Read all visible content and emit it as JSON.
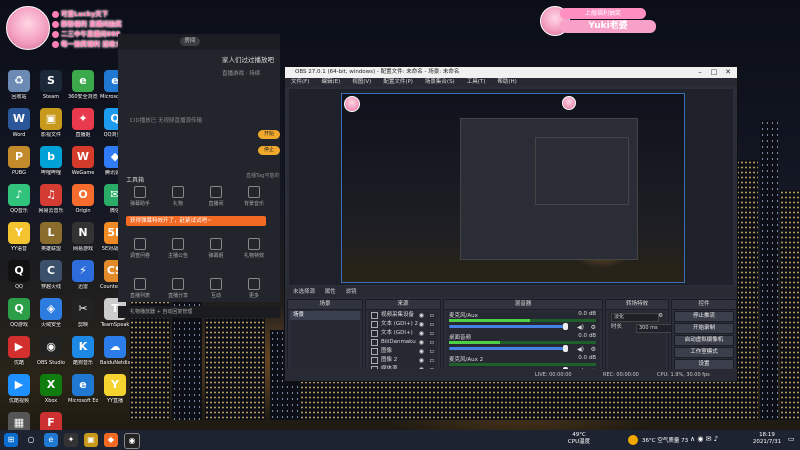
{
  "overlay": {
    "lines": [
      "可爱Lucky天下",
      "新粉福利 直播间抽奖",
      "二三中午直播间888",
      "每一抽奖福利 送给大家"
    ],
    "yuki_top": "上舰福利抽奖",
    "yuki_name": "Yuki老婆"
  },
  "desktop_icons": [
    {
      "label": "回收站",
      "glyph": "♻",
      "color": "#6b8bb5"
    },
    {
      "label": "Steam",
      "glyph": "S",
      "color": "#1b2838"
    },
    {
      "label": "360安全浏览器",
      "glyph": "e",
      "color": "#3aa84b"
    },
    {
      "label": "Microsoft Edge",
      "glyph": "e",
      "color": "#1f78d1"
    },
    {
      "label": "Word",
      "glyph": "W",
      "color": "#2b579a"
    },
    {
      "label": "影视文件",
      "glyph": "▣",
      "color": "#c79a1c"
    },
    {
      "label": "直播姬",
      "glyph": "✦",
      "color": "#e83a4c"
    },
    {
      "label": "QQ浏览器",
      "glyph": "Q",
      "color": "#1d9bf0"
    },
    {
      "label": "PUBG",
      "glyph": "P",
      "color": "#c28a2a"
    },
    {
      "label": "哔哩哔哩",
      "glyph": "b",
      "color": "#00a1d6"
    },
    {
      "label": "WeGame",
      "glyph": "W",
      "color": "#d43b2a"
    },
    {
      "label": "腾讯会议",
      "glyph": "◆",
      "color": "#2f7cf6"
    },
    {
      "label": "QQ音乐",
      "glyph": "♪",
      "color": "#31c27c"
    },
    {
      "label": "网易云音乐",
      "glyph": "♫",
      "color": "#d43c33"
    },
    {
      "label": "Origin",
      "glyph": "O",
      "color": "#f56c2d"
    },
    {
      "label": "微信",
      "glyph": "✉",
      "color": "#2aae67"
    },
    {
      "label": "YY语音",
      "glyph": "Y",
      "color": "#f4c430"
    },
    {
      "label": "英雄联盟",
      "glyph": "L",
      "color": "#8a6d2d"
    },
    {
      "label": "网易游戏",
      "glyph": "N",
      "color": "#333"
    },
    {
      "label": "5E对战平台",
      "glyph": "5E",
      "color": "#f08a24"
    },
    {
      "label": "QQ",
      "glyph": "Q",
      "color": "#111"
    },
    {
      "label": "穿越火线",
      "glyph": "C",
      "color": "#3a506b"
    },
    {
      "label": "迅雷",
      "glyph": "⚡",
      "color": "#2d6ddb"
    },
    {
      "label": "Counter-Strike",
      "glyph": "CS",
      "color": "#e38b2a"
    },
    {
      "label": "QQ游戏",
      "glyph": "Q",
      "color": "#2b9e47"
    },
    {
      "label": "火绒安全",
      "glyph": "◈",
      "color": "#2d7de0"
    },
    {
      "label": "剪映",
      "glyph": "✂",
      "color": "#222"
    },
    {
      "label": "TeamSpeak",
      "glyph": "T",
      "color": "#ccc"
    },
    {
      "label": "优酷",
      "glyph": "▶",
      "color": "#d42f2f"
    },
    {
      "label": "OBS Studio",
      "glyph": "◉",
      "color": "#222"
    },
    {
      "label": "酷狗音乐",
      "glyph": "K",
      "color": "#1e88e5"
    },
    {
      "label": "BaiduNetdisk",
      "glyph": "☁",
      "color": "#2b7de9"
    },
    {
      "label": "优酷视频",
      "glyph": "▶",
      "color": "#1e90ff"
    },
    {
      "label": "Xbox",
      "glyph": "X",
      "color": "#107c10"
    },
    {
      "label": "Microsoft Edge",
      "glyph": "e",
      "color": "#1f78d1"
    },
    {
      "label": "YY直播",
      "glyph": "Y",
      "color": "#f6d42f"
    },
    {
      "label": "Media",
      "glyph": "▦",
      "color": "#555"
    },
    {
      "label": "Forwarder",
      "glyph": "F",
      "color": "#cc3030"
    }
  ],
  "helper": {
    "tab_label": "房间",
    "room_title": "家人们过过播放吧",
    "room_sub": "直播游戏 · 持续",
    "status_line": "CID播放已 无视频直播源传输",
    "btn_start": "开始",
    "btn_stop": "停止",
    "hint": "直播Tag可能的",
    "tools_title": "工具箱",
    "tools": [
      "弹幕助手",
      "礼物",
      "直播间",
      "背景音乐",
      "调查问卷",
      "主播公告",
      "弹幕姬",
      "礼物特效",
      "直播列表",
      "直播分享",
      "互动",
      "更多"
    ],
    "tip": "获得弹幕特效开了，赶紧试试吧~",
    "footer": "礼物播放器 + 自动回复管理"
  },
  "obs": {
    "title": "OBS 27.0.1 (64-bit, windows) - 配置文件: 未命名 - 场景: 未命名",
    "menu": [
      "文件(F)",
      "编辑(E)",
      "视图(V)",
      "配置文件(P)",
      "场景集合(S)",
      "工具(T)",
      "帮助(H)"
    ],
    "source_bar": [
      "未选择源",
      "属性",
      "滤镜"
    ],
    "scenes_title": "场景",
    "scenes": [
      "场景"
    ],
    "sources_title": "来源",
    "sources": [
      "视频采集设备",
      "文本 (GDI+) 2",
      "文本 (GDI+)",
      "BiliDanmaku",
      "图像",
      "图像 2",
      "媒体源"
    ],
    "mixer_title": "混音器",
    "mixer": [
      {
        "name": "麦克风/Aux",
        "db": "0.0 dB",
        "level": 0.55
      },
      {
        "name": "桌面音频",
        "db": "0.0 dB",
        "level": 0.35
      },
      {
        "name": "麦克风/Aux 2",
        "db": "0.0 dB",
        "level": 0.0
      }
    ],
    "transitions_title": "转场特效",
    "transition_type": "淡化",
    "duration_label": "时长",
    "duration": "300 ms",
    "controls_title": "控件",
    "controls": [
      "停止推流",
      "开始录制",
      "启动虚拟摄像机",
      "工作室模式",
      "设置",
      "退出"
    ],
    "status": [
      "LIVE: 00:00:00",
      "REC: 00:00:00",
      "CPU: 1.9%, 30.00 fps"
    ]
  },
  "taskbar": {
    "cpu_temp": "49°C",
    "cpu_label": "CPU温度",
    "weather": "36°C 空气质量 73",
    "time": "18:19",
    "date": "2021/7/31"
  }
}
